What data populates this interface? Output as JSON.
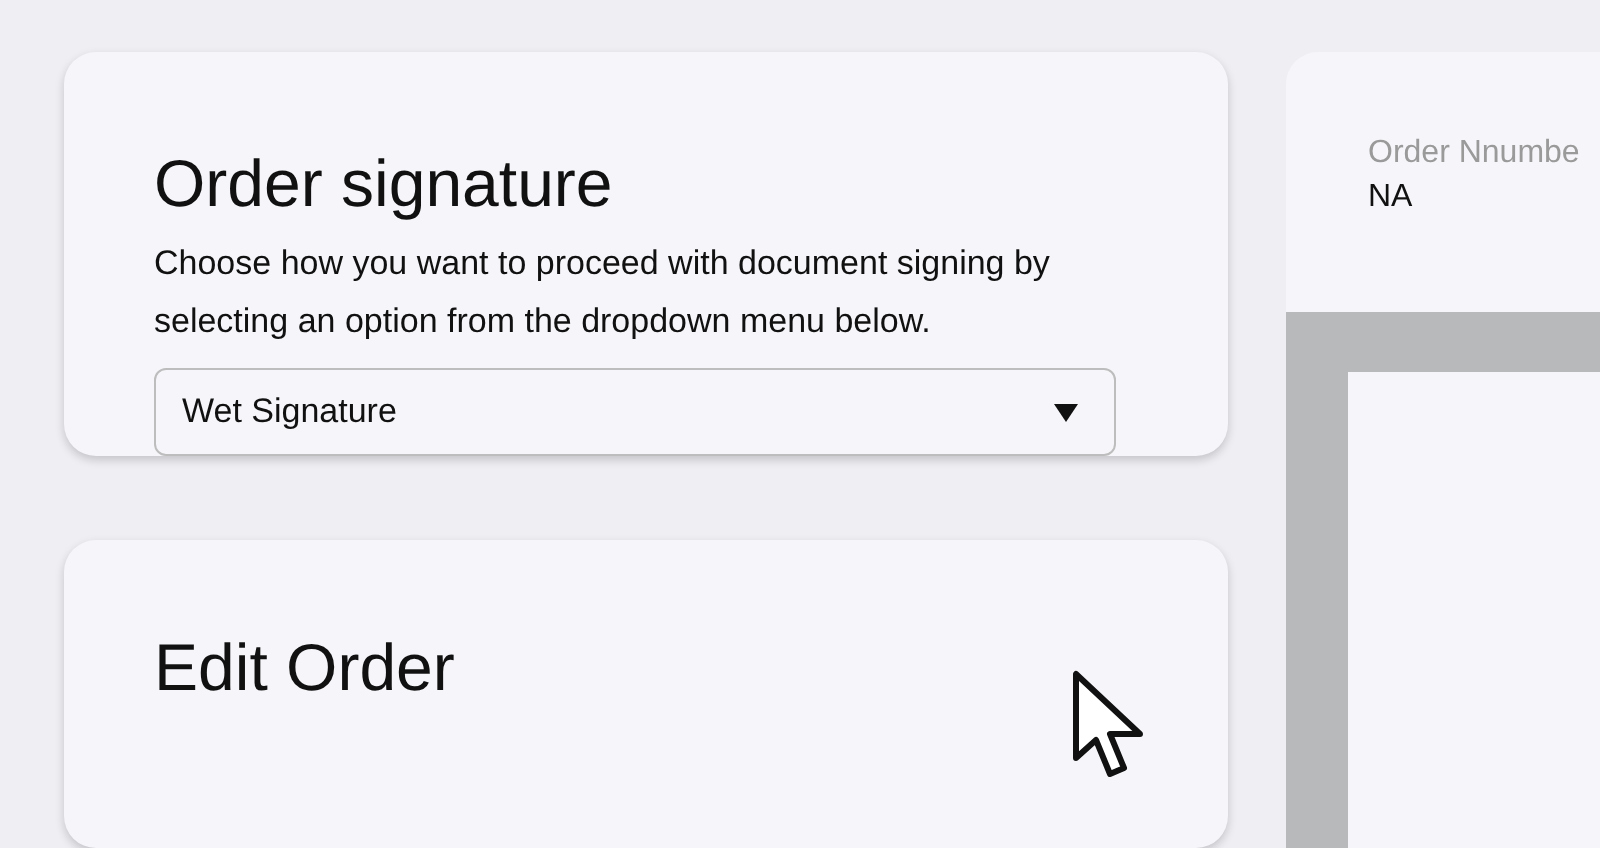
{
  "signature_card": {
    "title": "Order signature",
    "description": "Choose how you want to proceed with document signing by selecting an option from the dropdown menu below.",
    "dropdown": {
      "value": "Wet Signature"
    }
  },
  "edit_card": {
    "title": "Edit Order"
  },
  "order_panel": {
    "label": "Order Nnumbe",
    "value": "NA"
  }
}
